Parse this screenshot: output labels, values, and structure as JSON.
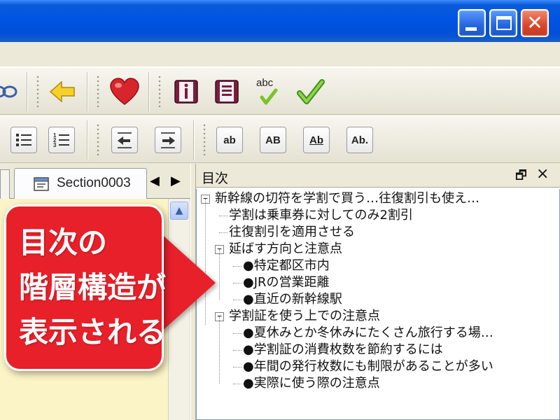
{
  "window": {
    "controls": {
      "minimize": "minimize",
      "maximize": "maximize",
      "close": "close"
    }
  },
  "toolbar1": {
    "icons": [
      "link-icon",
      "back-arrow-icon",
      "heart-icon",
      "info-book-icon",
      "list-book-icon",
      "spellcheck-icon",
      "check-icon"
    ],
    "spellcheck_text": "abc"
  },
  "toolbar2": {
    "icons": [
      "bullet-list-icon",
      "numbered-list-icon",
      "outdent-icon",
      "indent-icon"
    ],
    "style_buttons": [
      "ab",
      "AB",
      "Ab",
      "Ab."
    ]
  },
  "document": {
    "tab_label": "Section0003",
    "nav_prev": "◀",
    "nav_next": "▶"
  },
  "toc": {
    "title": "目次",
    "float_glyph": "🗗",
    "close_glyph": "×",
    "items": [
      {
        "level": 0,
        "toggle": "−",
        "label": "新幹線の切符を学割で買う…往復割引も使え…"
      },
      {
        "level": 1,
        "toggle": "",
        "label": "学割は乗車券に対してのみ2割引"
      },
      {
        "level": 1,
        "toggle": "",
        "label": "往復割引を適用させる"
      },
      {
        "level": 1,
        "toggle": "−",
        "label": "延ばす方向と注意点"
      },
      {
        "level": 2,
        "toggle": "",
        "label": "●特定都区市内"
      },
      {
        "level": 2,
        "toggle": "",
        "label": "●JRの営業距離"
      },
      {
        "level": 2,
        "toggle": "",
        "label": "●直近の新幹線駅"
      },
      {
        "level": 1,
        "toggle": "−",
        "label": "学割証を使う上での注意点"
      },
      {
        "level": 2,
        "toggle": "",
        "label": "●夏休みとか冬休みにたくさん旅行する場…"
      },
      {
        "level": 2,
        "toggle": "",
        "label": "●学割証の消費枚数を節約するには"
      },
      {
        "level": 2,
        "toggle": "",
        "label": "●年間の発行枚数にも制限があることが多い"
      },
      {
        "level": 2,
        "toggle": "",
        "label": "●実際に使う際の注意点"
      }
    ]
  },
  "callout": {
    "lines": [
      "目次の",
      "階層構造が",
      "表示される"
    ]
  },
  "colors": {
    "titlebar": "#0054e3",
    "callout": "#e8202a",
    "doc_background": "#fbf4c6"
  }
}
